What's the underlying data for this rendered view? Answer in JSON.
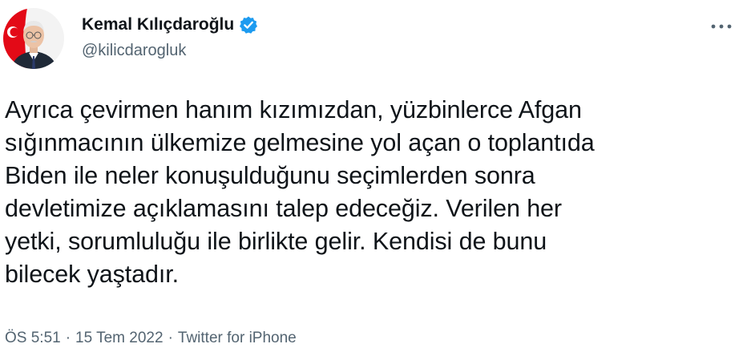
{
  "author": {
    "display_name": "Kemal Kılıçdaroğlu",
    "handle": "@kilicdarogluk",
    "verified": true,
    "verified_color": "#1d9bf0"
  },
  "tweet": {
    "text": "Ayrıca çevirmen hanım kızımızdan, yüzbinlerce Afgan\nsığınmacının ülkemize gelmesine yol açan o toplantıda\nBiden ile neler konuşulduğunu seçimlerden sonra\ndevletimize açıklamasını talep edeceğiz. Verilen her\nyetki, sorumluluğu ile birlikte gelir. Kendisi de bunu\nbilecek yaştadır.",
    "time": "ÖS 5:51",
    "date": "15 Tem 2022",
    "source": "Twitter for iPhone",
    "separator": "·"
  },
  "icons": {
    "more": "more-horizontal-icon",
    "verified": "verified-badge-icon"
  },
  "colors": {
    "text_primary": "#0f1419",
    "text_secondary": "#536471",
    "flag_red": "#e30a17"
  }
}
